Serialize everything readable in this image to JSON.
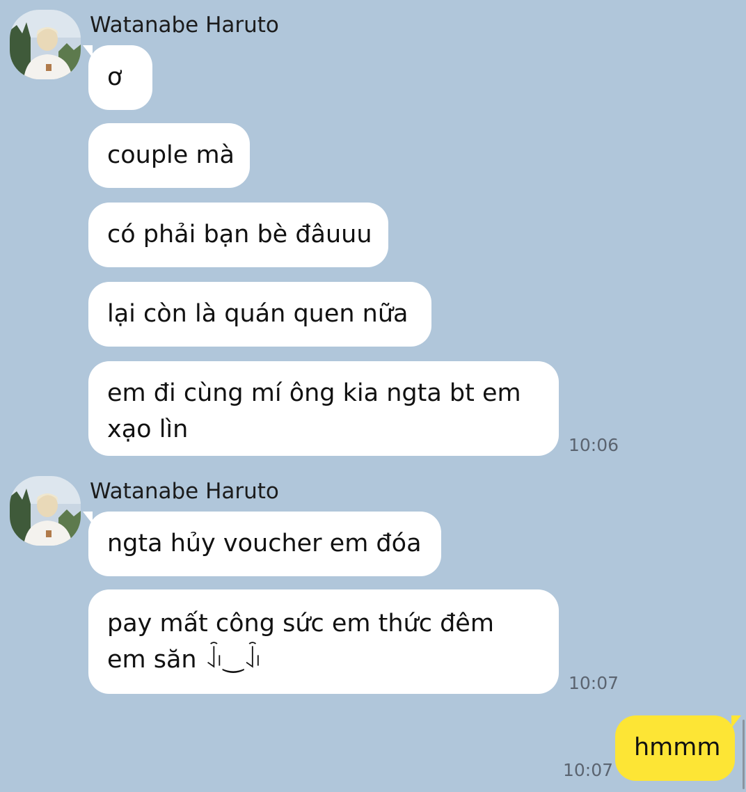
{
  "theme": {
    "background": "#b0c6da",
    "incoming_bubble": "#ffffff",
    "outgoing_bubble": "#fde535",
    "timestamp_color": "#5b6470"
  },
  "groups": [
    {
      "sender": "Watanabe Haruto",
      "avatar_icon": "profile-photo-icon",
      "messages": [
        "ơ",
        "couple mà",
        "có phải bạn bè đâuuu",
        "lại còn là quán quen nữa",
        "em đi cùng mí ông kia ngta bt em xạo lìn"
      ],
      "time": "10:06"
    },
    {
      "sender": "Watanabe Haruto",
      "avatar_icon": "profile-photo-icon",
      "messages": [
        "ngta hủy voucher em đóa",
        "pay mất công sức em thức đêm em săn ꀭ‿ꀭ"
      ],
      "time": "10:07"
    }
  ],
  "outgoing": {
    "text": "hmmm",
    "time": "10:07"
  }
}
